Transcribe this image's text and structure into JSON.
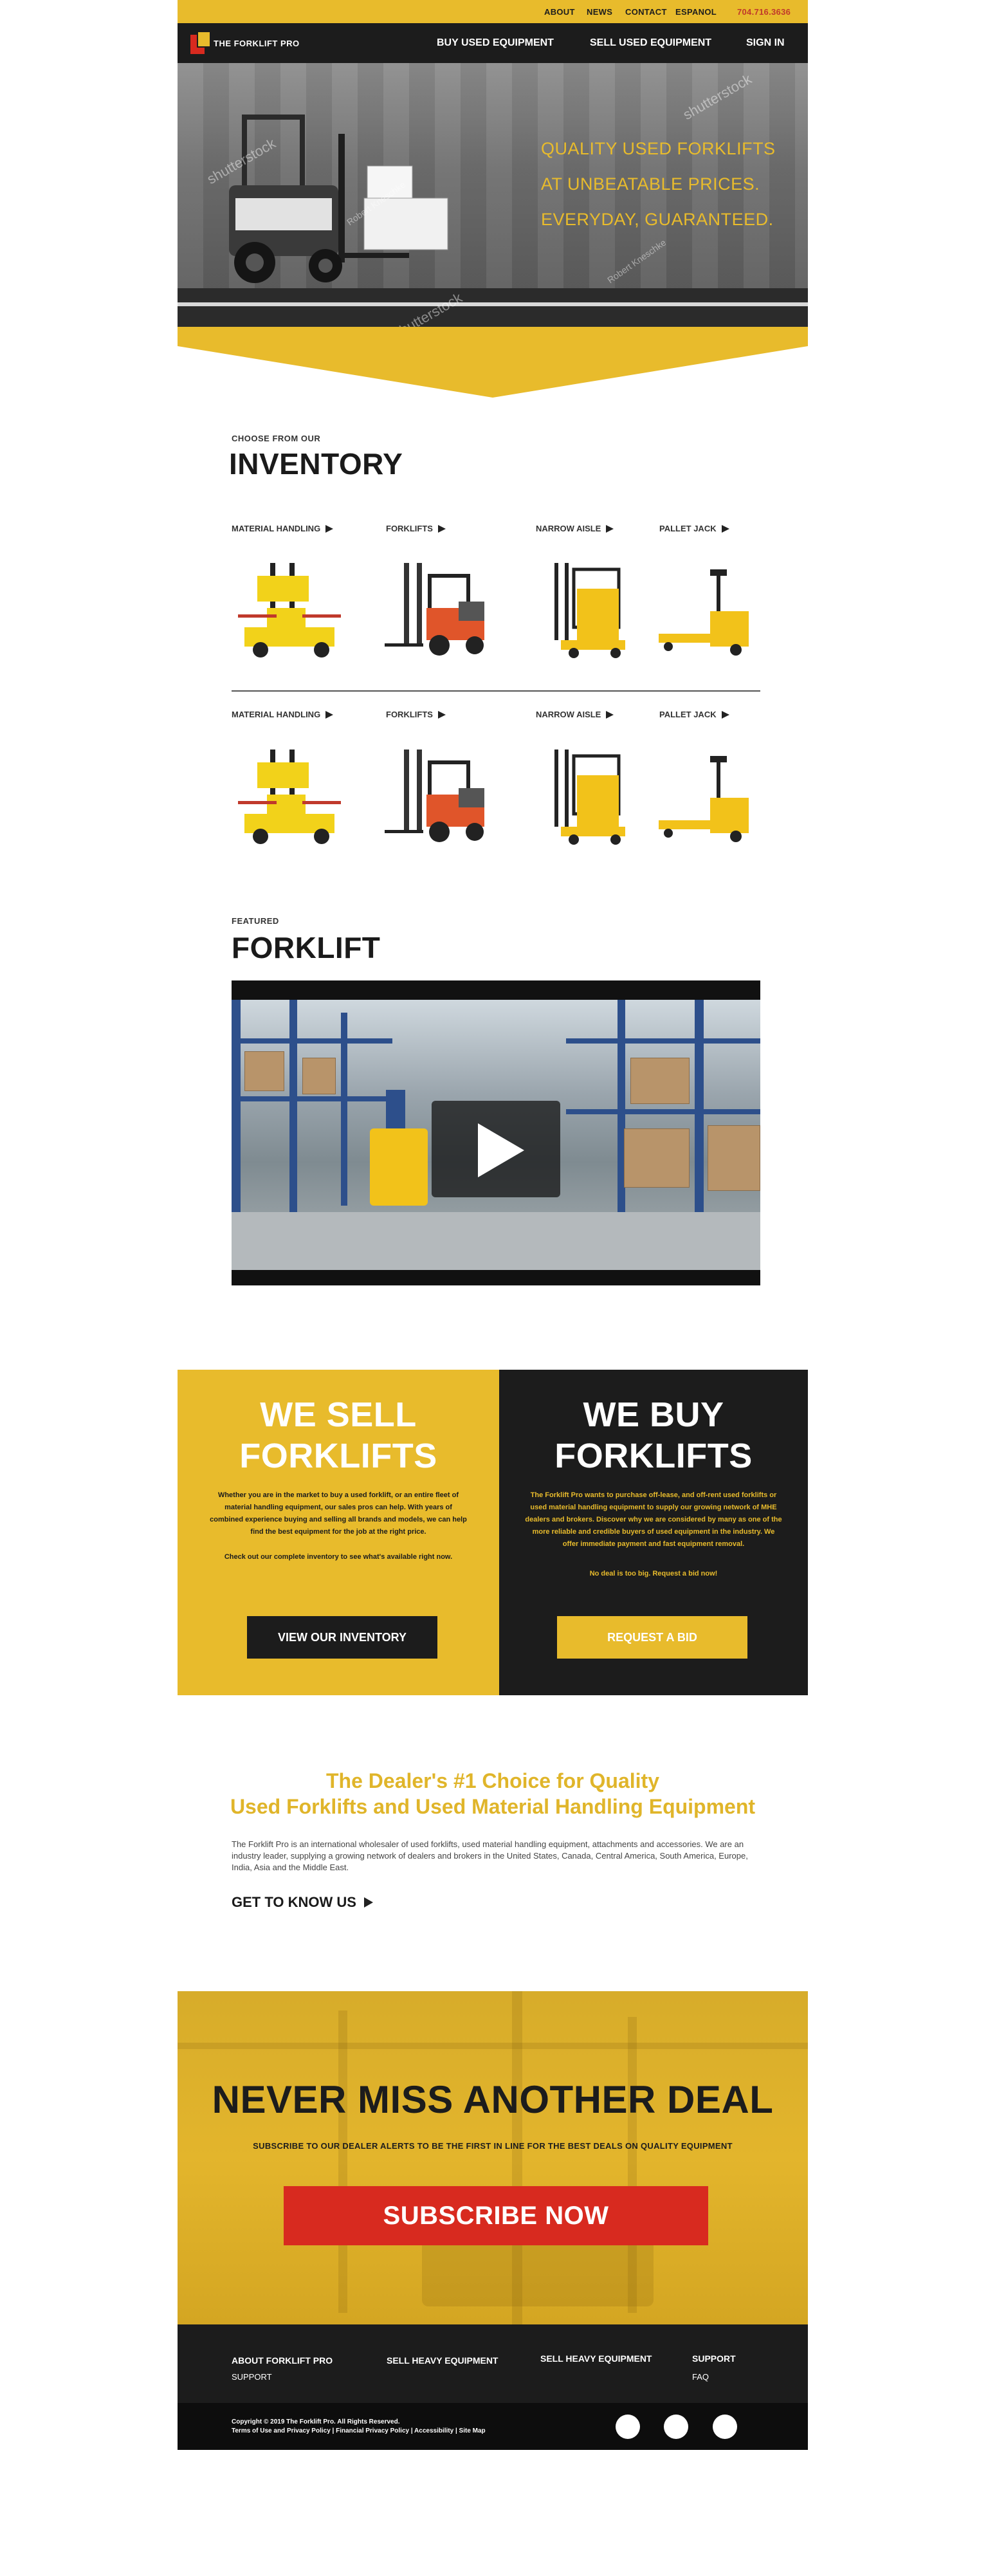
{
  "topbar": {
    "links": [
      "ABOUT",
      "NEWS",
      "CONTACT",
      "ESPANOL"
    ],
    "phone": "704.716.3636"
  },
  "nav": {
    "logo_text": "THE FORKLIFT PRO",
    "items": [
      "BUY USED EQUIPMENT",
      "SELL USED EQUIPMENT",
      "SIGN IN"
    ]
  },
  "hero": {
    "lines": [
      "QUALITY USED FORKLIFTS",
      "AT UNBEATABLE PRICES.",
      "EVERYDAY, GUARANTEED."
    ],
    "watermarks": [
      "shutterstock",
      "Robert Kneschke"
    ]
  },
  "inventory": {
    "eyebrow": "CHOOSE FROM OUR",
    "title": "INVENTORY",
    "categories": [
      "MATERIAL HANDLING",
      "FORKLIFTS",
      "NARROW AISLE",
      "PALLET JACK"
    ]
  },
  "featured": {
    "eyebrow": "FEATURED",
    "title": "FORKLIFT"
  },
  "sell": {
    "title_line1": "WE SELL",
    "title_line2": "FORKLIFTS",
    "body": "Whether you are in the market to buy a used forklift, or an entire fleet of material handling equipment, our sales pros can help. With years of combined experience buying and selling all brands and models, we can help find the best equipment for the job at the right price.",
    "body2": "Check out our complete inventory to see what's available right now.",
    "button": "VIEW OUR INVENTORY"
  },
  "buy": {
    "title_line1": "WE BUY",
    "title_line2": "FORKLIFTS",
    "body": "The Forklift Pro wants to purchase off-lease, and off-rent used forklifts or used material handling equipment to supply our growing network of MHE dealers and brokers. Discover why we are considered by many as one of the more reliable and credible buyers of used equipment in the industry. We offer immediate payment and fast equipment removal.",
    "body2": "No deal is too big. Request a bid now!",
    "button": "REQUEST A BID"
  },
  "dealer": {
    "line1": "The Dealer's #1 Choice for Quality",
    "line2": "Used Forklifts and Used Material Handling Equipment",
    "body": "The Forklift Pro is an international wholesaler of used forklifts, used material handling equipment, attachments and accessories. We are an industry leader, supplying a growing network of dealers and brokers in the United States, Canada, Central America, South America, Europe, India, Asia and the Middle East.",
    "link": "GET TO KNOW US"
  },
  "subscribe": {
    "title": "NEVER MISS ANOTHER DEAL",
    "subtitle": "SUBSCRIBE TO OUR DEALER ALERTS TO BE THE FIRST IN LINE FOR THE BEST DEALS ON QUALITY EQUIPMENT",
    "button": "SUBSCRIBE NOW"
  },
  "footer": {
    "about": "ABOUT FORKLIFT PRO",
    "support_sub": "SUPPORT",
    "sell1": "SELL HEAVY EQUIPMENT",
    "sell2": "SELL HEAVY EQUIPMENT",
    "support": "SUPPORT",
    "faq": "FAQ",
    "copyright": "Copyright © 2019 The Forklift Pro. All Rights Reserved.",
    "legal": "Terms of Use and Privacy Policy | Financial Privacy Policy | Accessibility | Site Map"
  },
  "colors": {
    "accent": "#e8bb2c",
    "dark": "#1c1c1c",
    "cta_red": "#d82a1f"
  }
}
